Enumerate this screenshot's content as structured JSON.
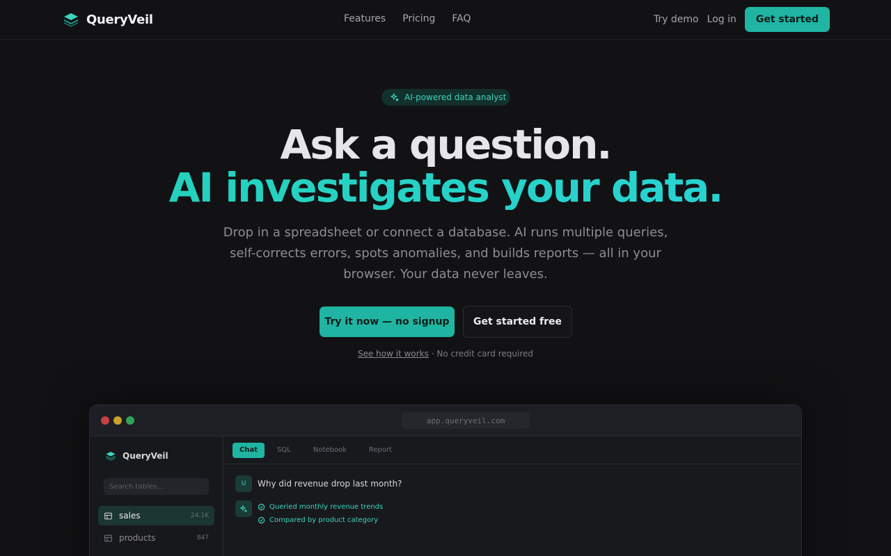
{
  "nav": {
    "brand": "QueryVeil",
    "links": [
      "Features",
      "Pricing",
      "FAQ"
    ],
    "try_demo": "Try demo",
    "log_in": "Log in",
    "get_started": "Get started"
  },
  "hero": {
    "badge": "AI-powered data analyst",
    "headline_1": "Ask a question.",
    "headline_2": "AI investigates your data.",
    "subtitle": "Drop in a spreadsheet or connect a database. AI runs multiple queries, self-corrects errors, spots anomalies, and builds reports — all in your browser. Your data never leaves.",
    "cta_primary": "Try it now — no signup",
    "cta_secondary": "Get started free",
    "note_link": "See how it works",
    "note_text": " · No credit card required"
  },
  "app": {
    "url": "app.queryveil.com",
    "brand": "QueryVeil",
    "search_placeholder": "Search tables...",
    "tables": [
      {
        "name": "sales",
        "count": "24.1K"
      },
      {
        "name": "products",
        "count": "847"
      }
    ],
    "tabs": [
      "Chat",
      "SQL",
      "Notebook",
      "Report"
    ],
    "user_avatar": "U",
    "user_question": "Why did revenue drop last month?",
    "steps": [
      "Queried monthly revenue trends",
      "Compared by product category"
    ]
  },
  "colors": {
    "accent": "#1fb5a2",
    "accent_text": "#2dd6c0",
    "background": "#121214",
    "dot_red": "#c94040",
    "dot_yellow": "#c9a227",
    "dot_green": "#2ea556"
  }
}
